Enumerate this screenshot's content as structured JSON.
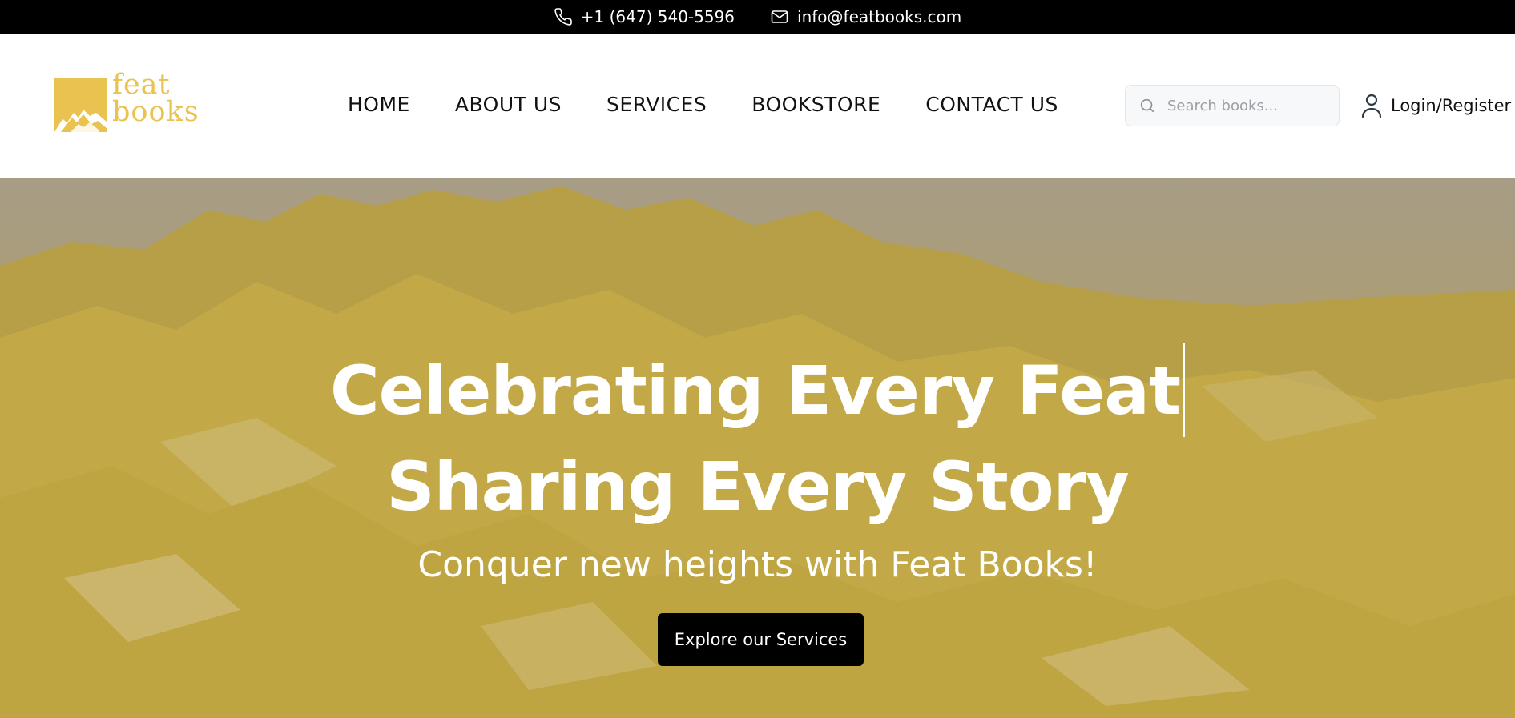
{
  "topbar": {
    "phone": "+1 (647) 540-5596",
    "email": "info@featbooks.com",
    "phone_icon": "phone-icon",
    "email_icon": "mail-icon"
  },
  "header": {
    "logo": {
      "line1": "feat",
      "line2": "books"
    },
    "nav": [
      "HOME",
      "ABOUT US",
      "SERVICES",
      "BOOKSTORE",
      "CONTACT US"
    ],
    "search": {
      "placeholder": "Search books...",
      "value": ""
    },
    "login_label": "Login/Register"
  },
  "hero": {
    "headline_line1": "Celebrating Every Feat",
    "headline_line2": "Sharing Every Story",
    "subheadline": "Conquer new heights with Feat Books!",
    "cta_label": "Explore our Services"
  },
  "colors": {
    "brand_gold": "#e9c24f",
    "hero_tint": "#b8a04a",
    "topbar_bg": "#000000",
    "cta_bg": "#000000"
  }
}
